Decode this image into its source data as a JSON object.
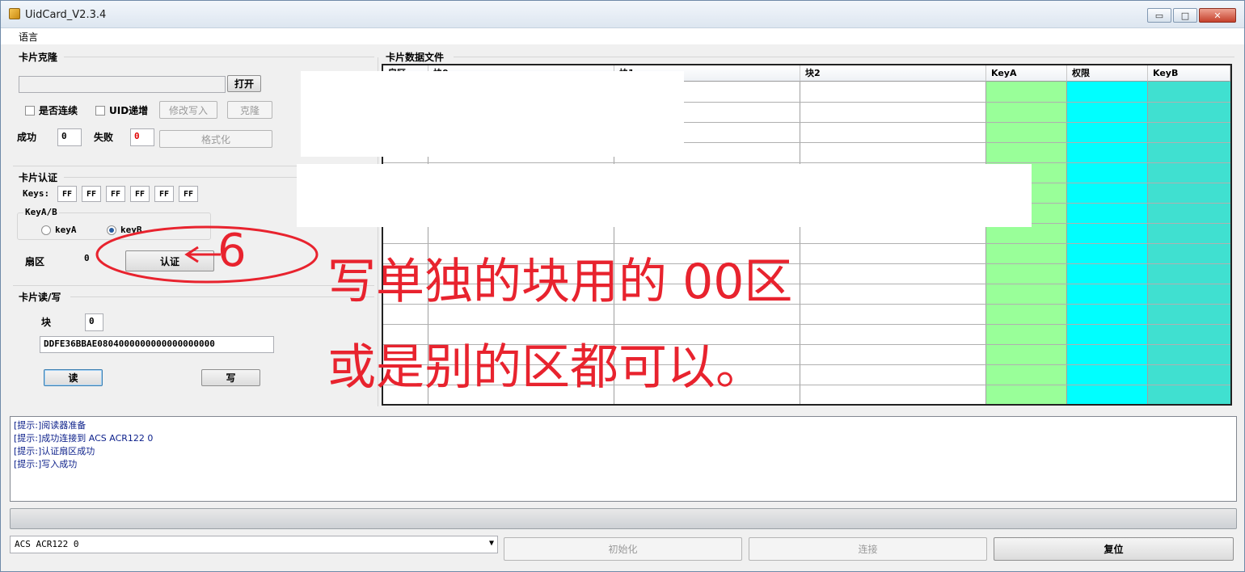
{
  "window": {
    "title": "UidCard_V2.3.4",
    "min_glyph": "▭",
    "max_glyph": "□",
    "close_glyph": "✕"
  },
  "menu": {
    "language": "语言"
  },
  "clone": {
    "title": "卡片克隆",
    "path_value": "",
    "open_label": "打开",
    "continuous_label": "是否连续",
    "uid_increment_label": "UID递增",
    "modify_write_label": "修改写入",
    "clone_label": "克隆",
    "success_label": "成功",
    "success_value": "0",
    "fail_label": "失败",
    "fail_value": "0",
    "format_label": "格式化"
  },
  "auth": {
    "title": "卡片认证",
    "keys_label": "Keys:",
    "keys": [
      "FF",
      "FF",
      "FF",
      "FF",
      "FF",
      "FF"
    ],
    "keyab_title": "KeyA/B",
    "keya_label": "keyA",
    "keyb_label": "keyB",
    "sector_label": "扇区",
    "sector_value": "0",
    "auth_button": "认证"
  },
  "rw": {
    "title": "卡片读/写",
    "block_label": "块",
    "block_value": "0",
    "data_value": "DDFE36BBAE0804000000000000000000",
    "read_label": "读",
    "write_label": "写"
  },
  "grid": {
    "title": "卡片数据文件",
    "headers": [
      "扇区",
      "块0",
      "块1",
      "块2",
      "KeyA",
      "权限",
      "KeyB"
    ],
    "colors": {
      "keya": "#99ff99",
      "access": "#00ffff",
      "keyb": "#40e0d0"
    }
  },
  "annotation": {
    "number": "6",
    "line1": "写单独的块用的 00区",
    "line2": "或是别的区都可以。",
    "color": "#e8232e"
  },
  "log": {
    "lines": [
      "[提示:]阅读器准备",
      "[提示:]成功连接到 ACS ACR122 0",
      "[提示:]认证扇区成功",
      "[提示:]写入成功"
    ]
  },
  "bottom": {
    "reader_value": "ACS ACR122 0",
    "init_label": "初始化",
    "connect_label": "连接",
    "reset_label": "复位"
  }
}
